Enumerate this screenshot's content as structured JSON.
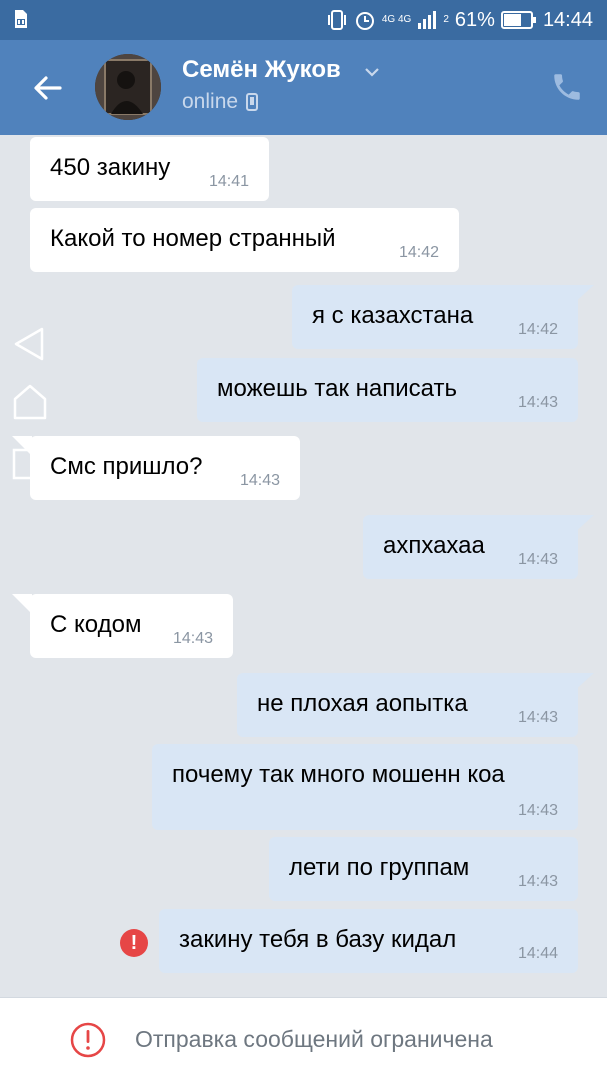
{
  "status_bar": {
    "network": "4G 4G",
    "sim_slot": "2",
    "battery_percent": "61%",
    "time": "14:44",
    "icons": [
      "sim-card-icon",
      "vibrate-icon",
      "alarm-icon",
      "signal-icon",
      "battery-icon"
    ]
  },
  "header": {
    "contact_name": "Семён Жуков",
    "presence": "online",
    "icons": [
      "back-arrow-icon",
      "chevron-down-icon",
      "mobile-device-icon",
      "phone-icon"
    ]
  },
  "messages": [
    {
      "dir": "in",
      "text": "450 закину",
      "time": "14:41"
    },
    {
      "dir": "in",
      "text": "Какой то номер странный",
      "time": "14:42"
    },
    {
      "dir": "out",
      "text": "я с казахстана",
      "time": "14:42"
    },
    {
      "dir": "out",
      "text": "можешь так написать",
      "time": "14:43"
    },
    {
      "dir": "in",
      "text": "Смс пришло?",
      "time": "14:43"
    },
    {
      "dir": "out",
      "text": "ахпхахаа",
      "time": "14:43"
    },
    {
      "dir": "in",
      "text": "С кодом",
      "time": "14:43"
    },
    {
      "dir": "out",
      "text": "не плохая аопытка",
      "time": "14:43"
    },
    {
      "dir": "out",
      "text": "почему так много мошенн коа",
      "time": "14:43"
    },
    {
      "dir": "out",
      "text": "лети по группам",
      "time": "14:43"
    },
    {
      "dir": "out",
      "text": "закину тебя в базу кидал",
      "time": "14:44",
      "error": true
    }
  ],
  "error_mark": "!",
  "bottom_notice": {
    "text": "Отправка сообщений ограничена",
    "icon": "alert-circle-icon"
  },
  "colors": {
    "status_bar": "#3a6ba1",
    "header": "#5082bc",
    "background": "#e1e5ea",
    "incoming_bubble": "#ffffff",
    "outgoing_bubble": "#d9e6f5",
    "error": "#e64646"
  }
}
